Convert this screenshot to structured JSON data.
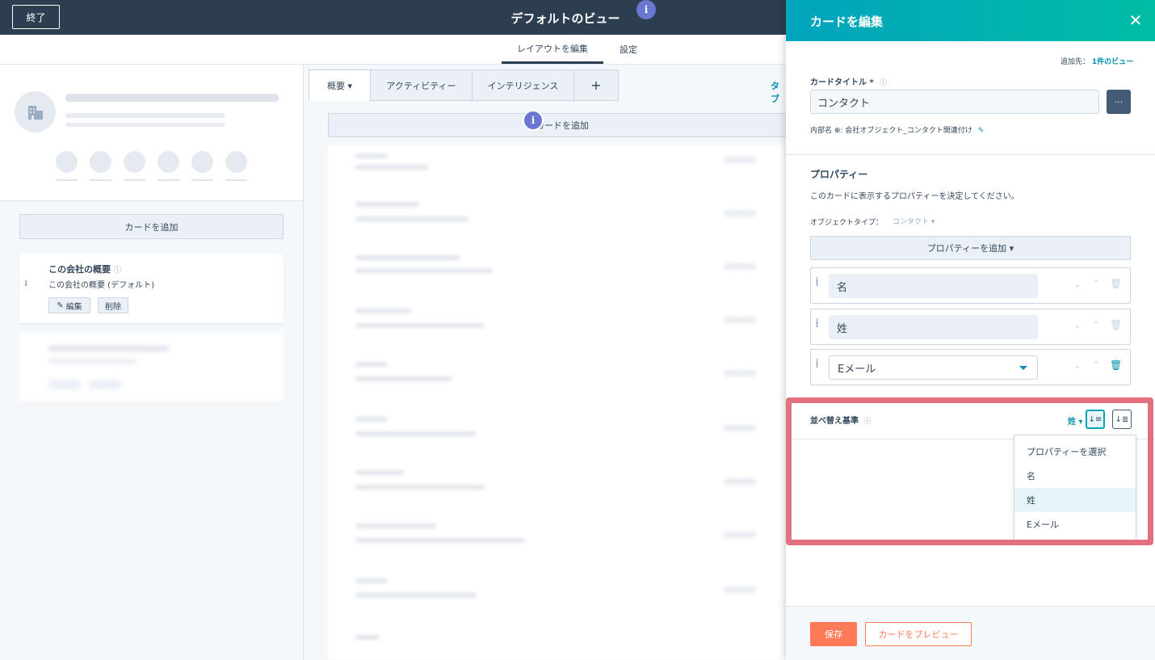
{
  "topbar": {
    "exit_label": "終了",
    "title": "デフォルトのビュー",
    "info_glyph": "i"
  },
  "subnav": {
    "tabs": [
      {
        "label": "レイアウトを編集",
        "active": true
      },
      {
        "label": "設定",
        "active": false
      }
    ]
  },
  "left": {
    "add_card_label": "カードを追加",
    "card": {
      "title": "この会社の概要",
      "subtitle": "この会社の概要 (デフォルト)",
      "edit_label": "編集",
      "delete_label": "削除"
    }
  },
  "middle": {
    "tabs": [
      {
        "label": "概要 ▾"
      },
      {
        "label": "アクティビティー"
      },
      {
        "label": "インテリジェンス"
      },
      {
        "label": "+"
      }
    ],
    "tab_link": "タブ",
    "add_card_label": "カードを追加",
    "info_glyph": "i"
  },
  "panel": {
    "title": "カードを編集",
    "close_glyph": "✕",
    "add_to_label": "追加先：",
    "add_to_link": "1件のビュー",
    "card_title_label": "カードタイトル *",
    "card_title_value": "コンタクト",
    "more_glyph": "···",
    "internal_name_label": "内部名 ⊕:",
    "internal_name_value": "会社オブジェクト_コンタクト関連付け",
    "properties": {
      "title": "プロパティー",
      "description": "このカードに表示するプロパティーを決定してください。",
      "object_type_label": "オブジェクトタイプ：",
      "object_type_value": "コンタクト ▾",
      "add_button": "プロパティーを追加 ▾",
      "rows": [
        {
          "value": "名"
        },
        {
          "value": "姓"
        },
        {
          "value": "Eメール"
        }
      ]
    },
    "sort": {
      "title": "並べ替え基準",
      "current": "姓 ▾",
      "options": [
        "プロパティーを選択",
        "名",
        "姓",
        "Eメール"
      ],
      "selected_index": 2
    },
    "footer": {
      "save_label": "保存",
      "preview_label": "カードをプレビュー"
    }
  },
  "colors": {
    "topbar": "#2d3e50",
    "accent_teal": "#00a4bd",
    "primary_orange": "#ff7a59",
    "highlight": "#e2707f"
  }
}
